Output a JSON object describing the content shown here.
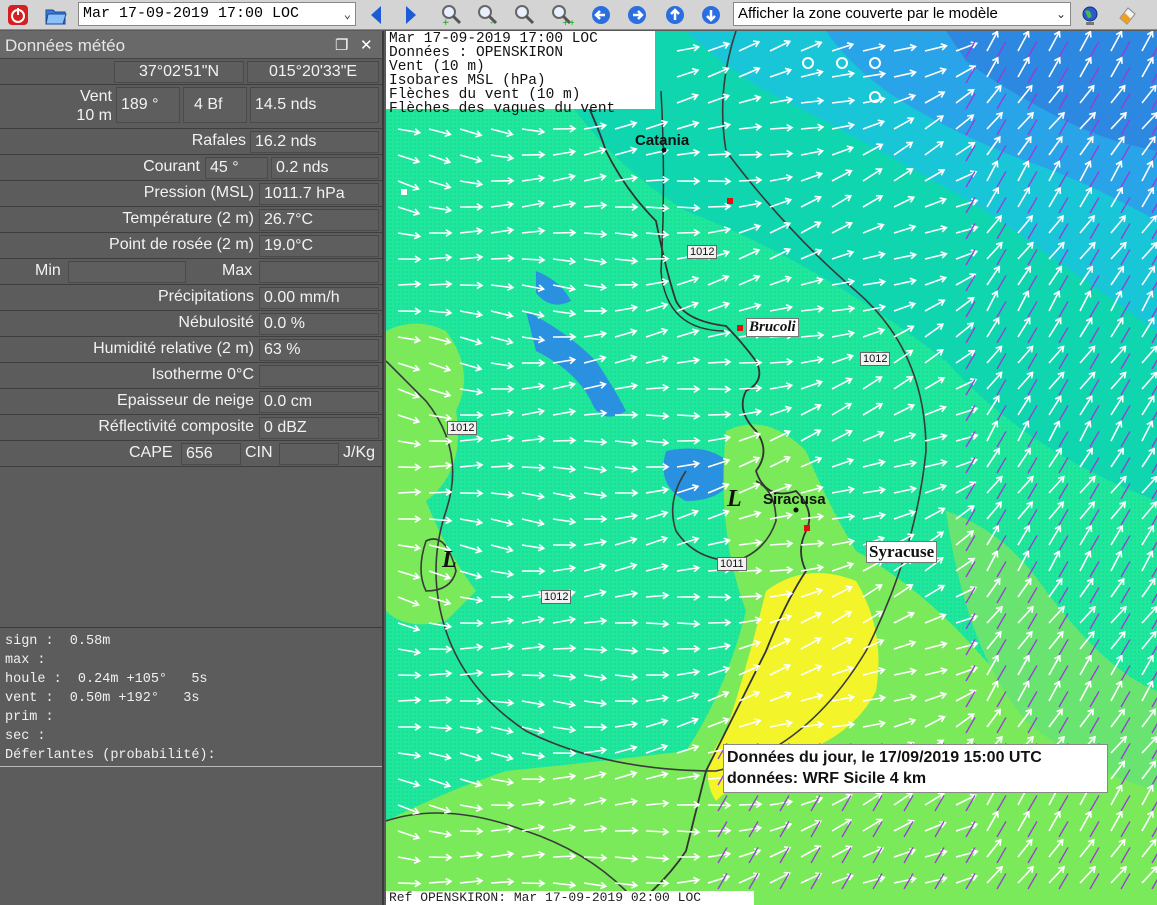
{
  "toolbar": {
    "date_value": "Mar 17-09-2019 17:00 LOC",
    "zone_value": "Afficher la zone couverte par le modèle"
  },
  "panel": {
    "title": "Données météo",
    "lat": "37°02'51\"N",
    "lon": "015°20'33\"E",
    "wind_label_1": "Vent",
    "wind_label_2": "10 m",
    "wind_dir": "189 °",
    "wind_bf": "4 Bf",
    "wind_speed": "14.5  nds",
    "gust_label": "Rafales",
    "gust_value": "16.2  nds",
    "current_label": "Courant",
    "current_dir": "45 °",
    "current_speed": "0.2  nds",
    "pressure_label": "Pression (MSL)",
    "pressure_value": "1011.7 hPa",
    "temp_label": "Température (2 m)",
    "temp_value": "26.7°C",
    "dew_label": "Point de rosée (2 m)",
    "dew_value": "19.0°C",
    "min_label": "Min",
    "max_label": "Max",
    "precip_label": "Précipitations",
    "precip_value": "0.00 mm/h",
    "cloud_label": "Nébulosité",
    "cloud_value": "0.0 %",
    "humidity_label": "Humidité relative (2 m)",
    "humidity_value": "63 %",
    "iso0_label": "Isotherme 0°C",
    "snow_label": "Epaisseur de neige",
    "snow_value": "0.0 cm",
    "refl_label": "Réflectivité composite",
    "refl_value": "0 dBZ",
    "cape_label": "CAPE",
    "cape_value": "656",
    "cin_label": "CIN",
    "jkg_label": "J/Kg",
    "wave_text": "sign :  0.58m\nmax :\nhoule :  0.24m +105°   5s\nvent :  0.50m +192°   3s\nprim :\nsec :\nDéferlantes (probabilité):"
  },
  "map": {
    "info_text": "Mar 17-09-2019 17:00 LOC\nDonnées : OPENSKIRON\nVent (10 m)\nIsobares MSL (hPa)\nFlèches du vent (10 m)\nFlèches des vagues du vent",
    "ref_text": "Ref OPENSKIRON: Mar 17-09-2019 02:00 LOC",
    "note_line1": "Données du jour, le 17/09/2019 15:00 UTC",
    "note_line2": "données: WRF Sicile 4 km",
    "city_catania": "Catania",
    "city_brucoli": "Brucoli",
    "city_siracusa": "Siracusa",
    "city_syracuse": "Syracuse",
    "isobars": [
      "1012",
      "1012",
      "1012",
      "1011",
      "1012"
    ],
    "low_symbol": "L"
  },
  "colors": {
    "sea_light": "#20e890",
    "sea_mid": "#10d8a8",
    "sea_blue": "#2a8ae0",
    "land_green": "#7aec5a",
    "yellow": "#f6f62a"
  }
}
